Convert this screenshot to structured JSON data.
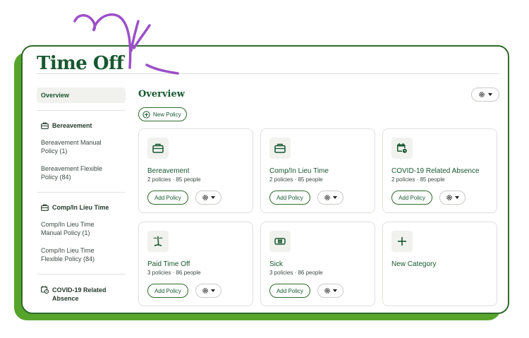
{
  "app": {
    "title": "Time Off"
  },
  "sidebar": {
    "overview_label": "Overview",
    "groups": [
      {
        "label": "Bereavement",
        "icon": "briefcase-icon",
        "items": [
          {
            "line1": "Bereavement Manual",
            "line2": "Policy (1)"
          },
          {
            "line1": "Bereavement Flexible",
            "line2": "Policy (84)"
          }
        ]
      },
      {
        "label": "Comp/In Lieu Time",
        "icon": "briefcase-icon",
        "items": [
          {
            "line1": "Comp/In Lieu Time",
            "line2": "Manual Policy (1)"
          },
          {
            "line1": "Comp/In Lieu Time",
            "line2": "Flexible Policy (84)"
          }
        ]
      },
      {
        "label_line1": "COVID-19 Related",
        "label_line2": "Absence",
        "icon": "calendar-clock-icon"
      }
    ]
  },
  "main": {
    "title": "Overview",
    "new_policy_label": "New Policy",
    "add_policy_label": "Add Policy",
    "cards": [
      {
        "title": "Bereavement",
        "meta": "2 policies · 85 people",
        "icon": "briefcase-icon"
      },
      {
        "title": "Comp/In Lieu Time",
        "meta": "2 policies · 85 people",
        "icon": "briefcase-icon"
      },
      {
        "title": "COVID-19 Related Absence",
        "meta": "2 policies · 85 people",
        "icon": "calendar-clock-icon"
      },
      {
        "title": "Paid Time Off",
        "meta": "3 policies · 86 people",
        "icon": "palm-tree-icon"
      },
      {
        "title": "Sick",
        "meta": "3 policies · 86 people",
        "icon": "bandage-icon"
      }
    ],
    "new_category_label": "New Category"
  },
  "colors": {
    "brand_green": "#17572f",
    "accent_green": "#57a42c",
    "deco_purple": "#9b4fc9"
  }
}
